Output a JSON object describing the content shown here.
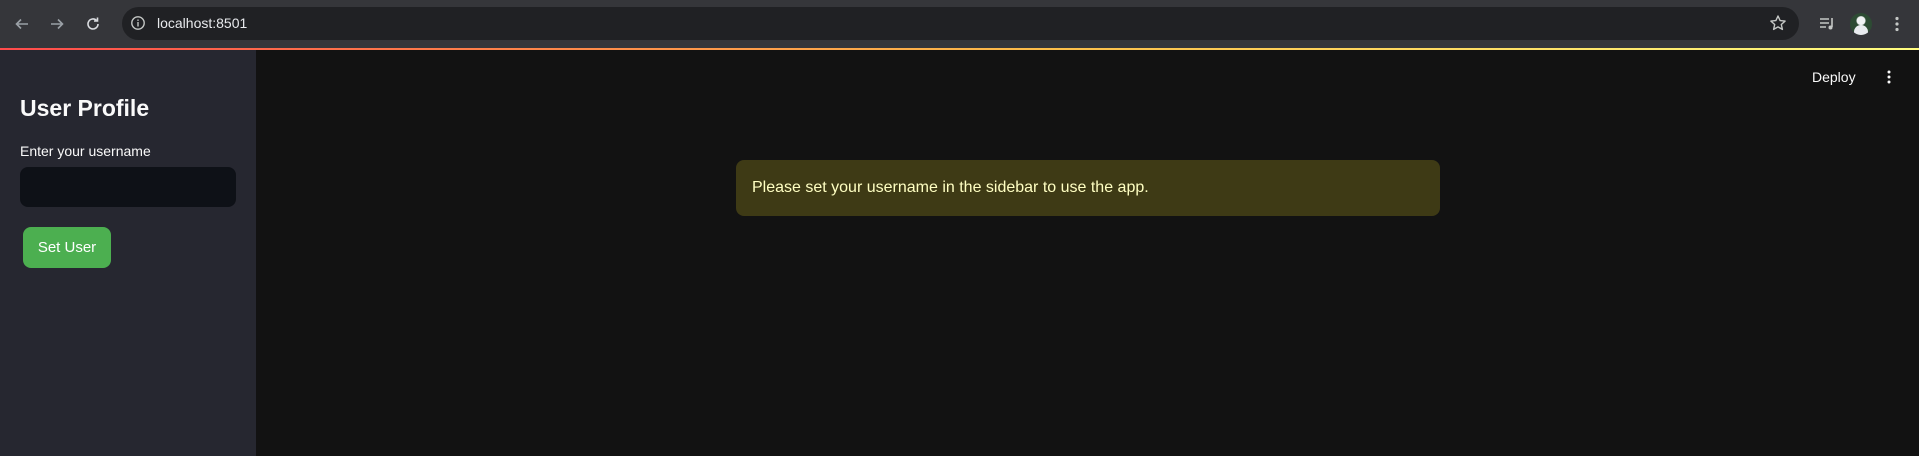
{
  "browser": {
    "url": "localhost:8501"
  },
  "header": {
    "deploy_label": "Deploy"
  },
  "sidebar": {
    "title": "User Profile",
    "username_label": "Enter your username",
    "username_value": "",
    "set_user_label": "Set User"
  },
  "main": {
    "warning_text": "Please set your username in the sidebar to use the app."
  },
  "colors": {
    "sidebar_bg": "#262730",
    "main_bg": "#121212",
    "primary_button": "#4caf50",
    "warning_bg": "#3e3a15",
    "warning_text": "#ffffc2"
  },
  "icons": [
    "back-arrow-icon",
    "forward-arrow-icon",
    "reload-icon",
    "site-info-icon",
    "bookmark-star-icon",
    "media-controls-icon",
    "more-vert-icon"
  ]
}
